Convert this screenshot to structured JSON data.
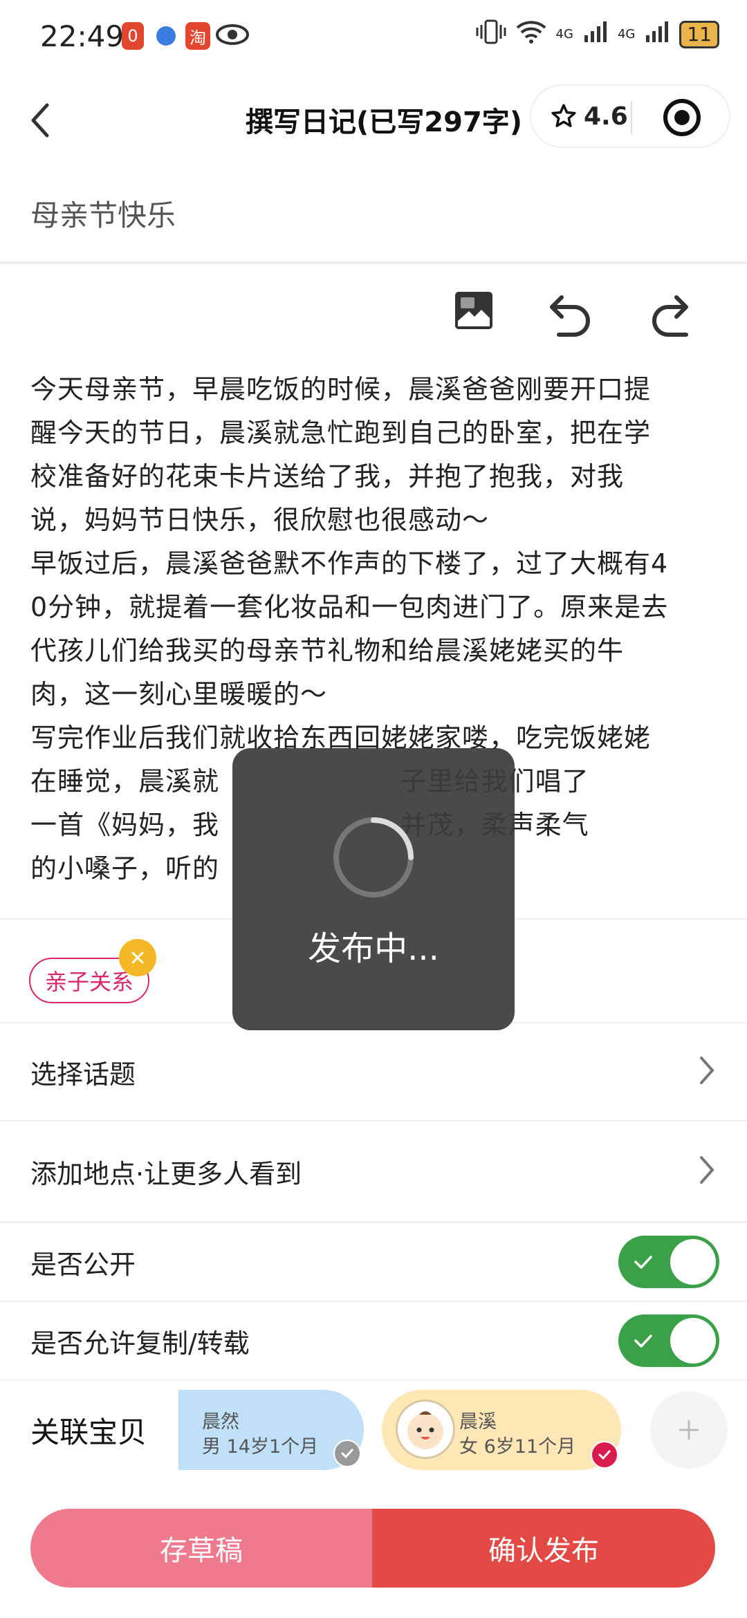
{
  "status_bar": {
    "time": "22:49",
    "app_icon_1": "0",
    "app_icon_3": "淘",
    "network_1": "4G",
    "network_2": "4G",
    "battery": "11"
  },
  "header": {
    "title": "撰写日记(已写297字)",
    "rating": "4.6"
  },
  "editor": {
    "subject": "母亲节快乐",
    "content_lines": [
      "今天母亲节，早晨吃饭的时候，晨溪爸爸刚要开口提",
      "醒今天的节日，晨溪就急忙跑到自己的卧室，把在学",
      "校准备好的花束卡片送给了我，并抱了抱我，对我",
      "说，妈妈节日快乐，很欣慰也很感动～",
      "早饭过后，晨溪爸爸默不作声的下楼了，过了大概有4",
      "0分钟，就提着一套化妆品和一包肉进门了。原来是去",
      "代孩儿们给我买的母亲节礼物和给晨溪姥姥买的牛",
      "肉，这一刻心里暖暖的～",
      "写完作业后我们就收拾东西回姥姥家喽，吃完饭姥姥",
      "在睡觉，晨溪就                    子里给我们唱了",
      "一首《妈妈，我                    并茂，柔声柔气",
      "的小嗓子，听的"
    ]
  },
  "tag": {
    "label": "亲子关系"
  },
  "options": {
    "topic": "选择话题",
    "location": "添加地点·让更多人看到",
    "public": "是否公开",
    "allow_copy": "是否允许复制/转载",
    "public_on": true,
    "allow_copy_on": true
  },
  "kids": {
    "label": "关联宝贝",
    "items": [
      {
        "name": "晨然",
        "info": "男  14岁1个月",
        "color": "#bfe0f7",
        "selected": false
      },
      {
        "name": "晨溪",
        "info": "女  6岁11个月",
        "color": "#fde7b5",
        "selected": true
      }
    ]
  },
  "actions": {
    "draft": "存草稿",
    "publish": "确认发布",
    "draft_color": "#ef7a8e",
    "publish_color": "#e34a45"
  },
  "loading": {
    "text": "发布中..."
  }
}
